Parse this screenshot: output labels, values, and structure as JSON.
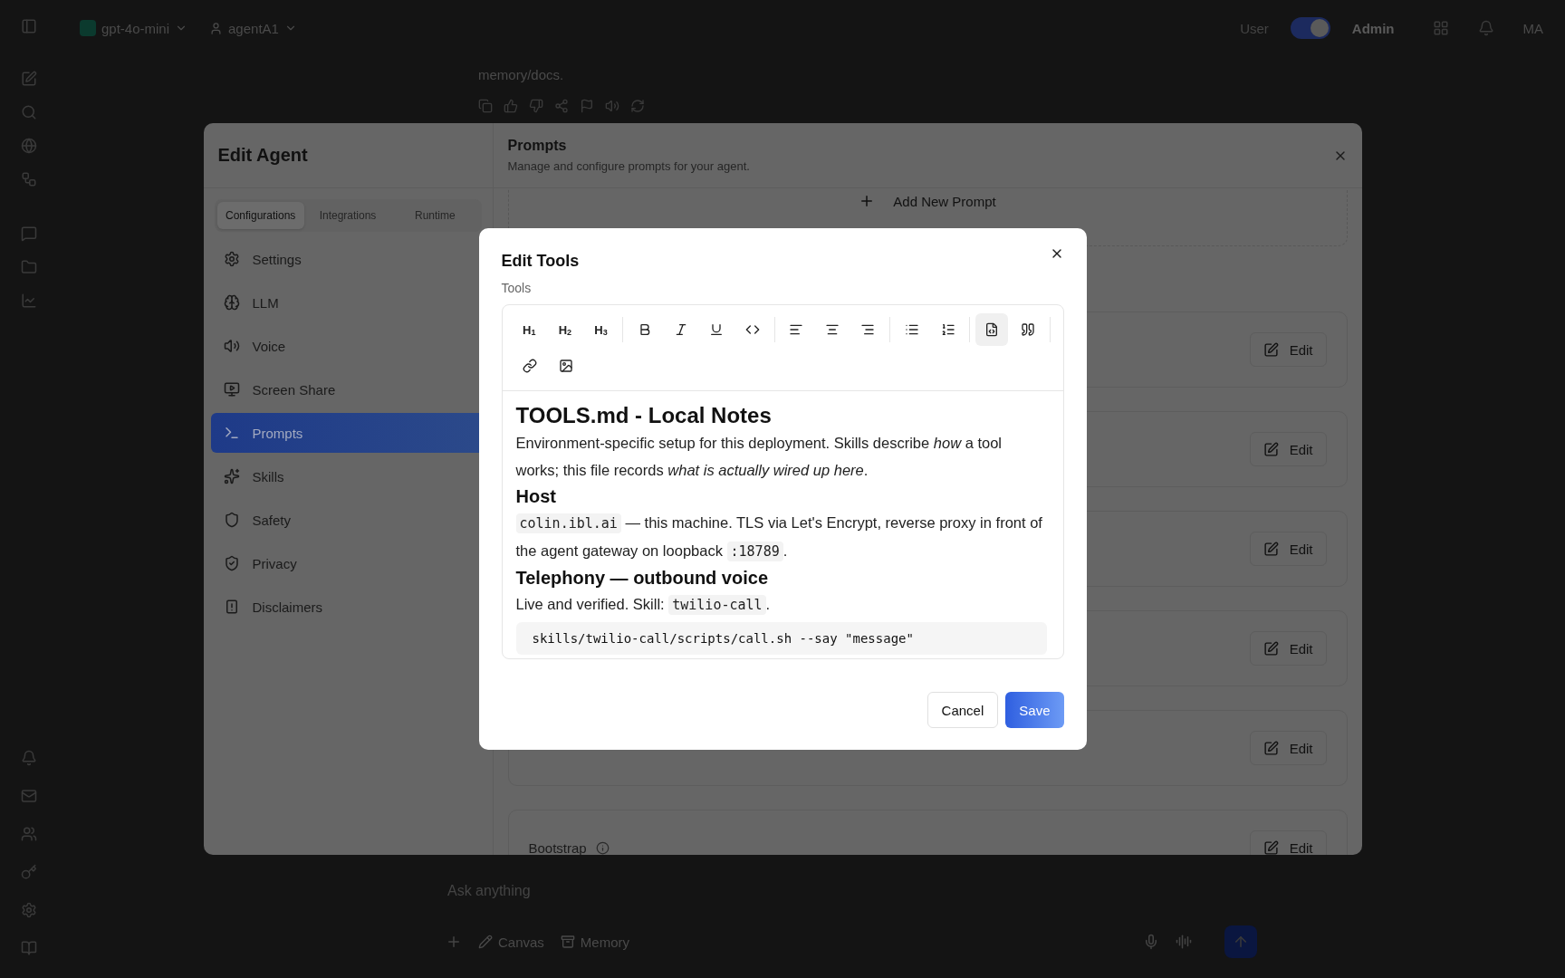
{
  "app": {
    "model": "gpt-4o-mini",
    "agent": "agentA1",
    "role_toggle": {
      "left": "User",
      "right": "Admin",
      "on": true
    },
    "avatar": "MA",
    "message": "memory/docs.",
    "composer": {
      "placeholder": "Ask anything",
      "tools": [
        "Canvas",
        "Memory"
      ]
    }
  },
  "edit_agent": {
    "title": "Edit Agent",
    "tabs": [
      {
        "label": "Configurations",
        "selected": true
      },
      {
        "label": "Integrations",
        "selected": false
      },
      {
        "label": "Runtime",
        "selected": false
      }
    ],
    "nav": [
      {
        "kind": "settings",
        "label": "Settings",
        "selected": false
      },
      {
        "kind": "llm",
        "label": "LLM",
        "selected": false
      },
      {
        "kind": "voice",
        "label": "Voice",
        "selected": false
      },
      {
        "kind": "screen",
        "label": "Screen Share",
        "selected": false
      },
      {
        "kind": "prompts",
        "label": "Prompts",
        "selected": true
      },
      {
        "kind": "skills",
        "label": "Skills",
        "selected": false
      },
      {
        "kind": "safety",
        "label": "Safety",
        "selected": false
      },
      {
        "kind": "privacy",
        "label": "Privacy",
        "selected": false
      },
      {
        "kind": "disclaimers",
        "label": "Disclaimers",
        "selected": false
      }
    ],
    "section": {
      "title": "Prompts",
      "subtitle": "Manage and configure prompts for your agent.",
      "add_button": "Add New Prompt",
      "cards": [
        {
          "edit_button": "Edit"
        },
        {
          "edit_button": "Edit"
        },
        {
          "edit_button": "Edit"
        },
        {
          "edit_button": "Edit"
        },
        {
          "edit_button": "Edit"
        },
        {
          "label": "Bootstrap",
          "edit_button": "Edit"
        }
      ]
    }
  },
  "edit_tools": {
    "title": "Edit Tools",
    "field_label": "Tools",
    "toolbar": {
      "rows": [
        {
          "groups": [
            {
              "buttons": [
                {
                  "kind": "h1",
                  "label": "H$_{1}$",
                  "selected": false
                },
                {
                  "kind": "h2",
                  "label": "H$_{2}$",
                  "selected": false
                },
                {
                  "kind": "h3",
                  "label": "H$_{3}$",
                  "selected": false
                }
              ]
            },
            {
              "buttons": [
                {
                  "kind": "bold",
                  "selected": false
                },
                {
                  "kind": "italic",
                  "selected": false
                },
                {
                  "kind": "underline",
                  "selected": false
                },
                {
                  "kind": "code",
                  "selected": false
                }
              ]
            },
            {
              "buttons": [
                {
                  "kind": "align-left",
                  "selected": false
                },
                {
                  "kind": "align-center",
                  "selected": false
                },
                {
                  "kind": "align-right",
                  "selected": false
                }
              ]
            },
            {
              "buttons": [
                {
                  "kind": "bullet-list",
                  "selected": false
                },
                {
                  "kind": "ordered-list",
                  "selected": false
                }
              ]
            },
            {
              "buttons": [
                {
                  "kind": "code-block",
                  "selected": true
                },
                {
                  "kind": "quote",
                  "selected": false
                }
              ]
            }
          ]
        },
        {
          "groups": [
            {
              "buttons": [
                {
                  "kind": "link",
                  "selected": false
                },
                {
                  "kind": "image",
                  "selected": false
                }
              ]
            }
          ]
        }
      ]
    },
    "document": [
      {
        "kind": "h1",
        "parts": [
          {
            "kind": "text",
            "text": "TOOLS.md - Local Notes"
          }
        ]
      },
      {
        "kind": "p",
        "parts": [
          {
            "kind": "text",
            "text": "Environment-specific setup for this deployment. Skills describe *how* a tool works; this file records *what is actually wired up here*."
          }
        ]
      },
      {
        "kind": "h2",
        "parts": [
          {
            "kind": "text",
            "text": "Host"
          }
        ]
      },
      {
        "kind": "p",
        "parts": [
          {
            "kind": "code",
            "text": "colin.ibl.ai"
          },
          {
            "kind": "text",
            "text": " — this machine. TLS via Let's Encrypt, reverse proxy in front of the agent gateway on loopback "
          },
          {
            "kind": "code",
            "text": ":18789"
          },
          {
            "kind": "text",
            "text": "."
          }
        ]
      },
      {
        "kind": "h2",
        "parts": [
          {
            "kind": "text",
            "text": "Telephony — outbound voice"
          }
        ]
      },
      {
        "kind": "p",
        "parts": [
          {
            "kind": "text",
            "text": "Live and verified. Skill: "
          },
          {
            "kind": "code",
            "text": "twilio-call"
          },
          {
            "kind": "text",
            "text": "."
          }
        ]
      },
      {
        "kind": "codeblock",
        "parts": [
          {
            "kind": "text",
            "text": "skills/twilio-call/scripts/call.sh --say \"message\""
          }
        ]
      }
    ],
    "buttons": {
      "cancel": "Cancel",
      "save": "Save"
    }
  }
}
